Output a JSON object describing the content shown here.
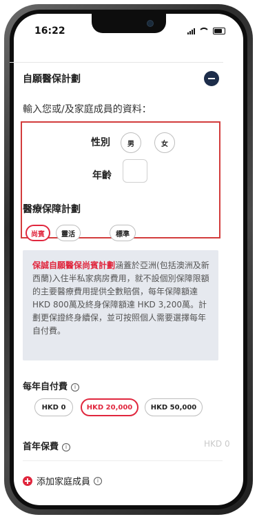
{
  "status": {
    "time": "16:22"
  },
  "section": {
    "title": "自願醫保計劃",
    "instruction": "輸入您或/及家庭成員的資料："
  },
  "gender": {
    "label": "性別",
    "male": "男",
    "female": "女"
  },
  "age": {
    "label": "年齡",
    "value": ""
  },
  "plan": {
    "label": "醫療保障計劃",
    "options": [
      "尚賓",
      "靈活",
      "標準"
    ],
    "selected": "尚賓"
  },
  "description": {
    "highlight": "保誠自願醫保尚賓計劃",
    "text": "涵蓋於亞洲(包括澳洲及新西蘭)入住半私家病房費用，就不設個別保障限額的主要醫療費用提供全數賠償，每年保障額達HKD 800萬及終身保障額達 HKD 3,200萬。計劃更保證終身續保，並可按照個人需要選擇每年自付費。"
  },
  "deductible": {
    "title": "每年自付費",
    "options": [
      "HKD 0",
      "HKD 20,000",
      "HKD 50,000"
    ],
    "selected": "HKD 20,000"
  },
  "premium": {
    "title": "首年保費",
    "value": "HKD 0"
  },
  "add_member": {
    "label": "添加家庭成員"
  },
  "colors": {
    "accent": "#e0263d",
    "navy": "#1d2d4a",
    "highlight_border": "#d23b3b"
  }
}
